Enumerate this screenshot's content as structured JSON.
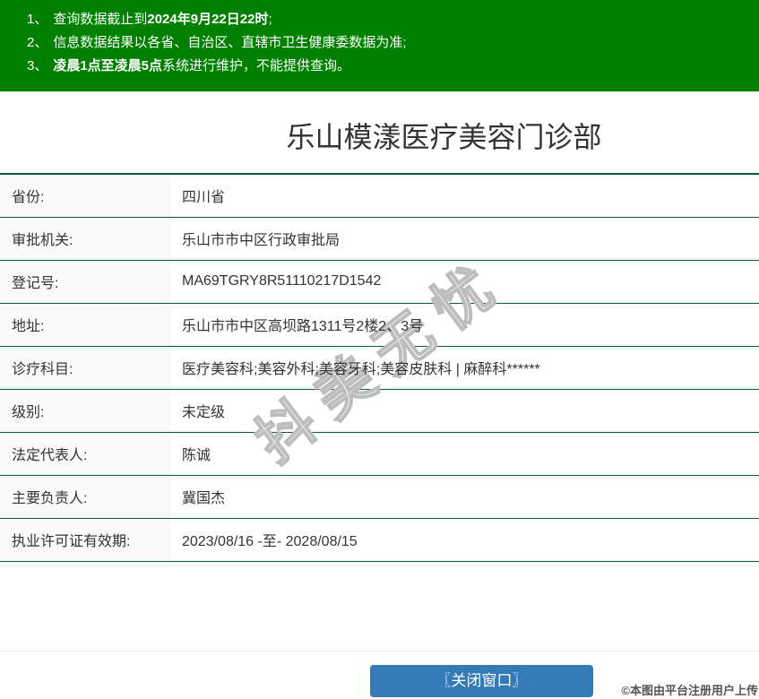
{
  "notice": {
    "items": [
      {
        "num": "1、",
        "pre": "查询数据截止到",
        "bold": "2024年9月22日22时",
        "post": ";"
      },
      {
        "num": "2、",
        "pre": "信息数据结果以各省、自治区、直辖市卫生健康委数据为准;",
        "bold": "",
        "post": ""
      },
      {
        "num": "3、",
        "pre": "",
        "bold": "凌晨1点至凌晨5点",
        "post": "系统进行维护，不能提供查询。"
      }
    ]
  },
  "title": "乐山模漾医疗美容门诊部",
  "table": {
    "rows": [
      {
        "label": "省份:",
        "value": "四川省"
      },
      {
        "label": "审批机关:",
        "value": "乐山市市中区行政审批局"
      },
      {
        "label": "登记号:",
        "value": "MA69TGRY8R51110217D1542"
      },
      {
        "label": "地址:",
        "value": "乐山市市中区高坝路1311号2楼2、3号"
      },
      {
        "label": "诊疗科目:",
        "value": "医疗美容科;美容外科;美容牙科;美容皮肤科 | 麻醉科******"
      },
      {
        "label": "级别:",
        "value": "未定级"
      },
      {
        "label": "法定代表人:",
        "value": "陈诚"
      },
      {
        "label": "主要负责人:",
        "value": "冀国杰"
      },
      {
        "label": "执业许可证有效期:",
        "value": "2023/08/16 -至- 2028/08/15"
      }
    ]
  },
  "watermark_text": "抖美无忧",
  "footer": {
    "close_button": "〖关闭窗口〗",
    "copyright": "©本图由平台注册用户上传"
  },
  "colors": {
    "banner_green": "#008000",
    "table_border_green": "#0b5d30",
    "button_blue": "#337ab7",
    "label_bg": "#fafafa",
    "text": "#333333",
    "watermark_stroke": "#bdbdbd"
  }
}
